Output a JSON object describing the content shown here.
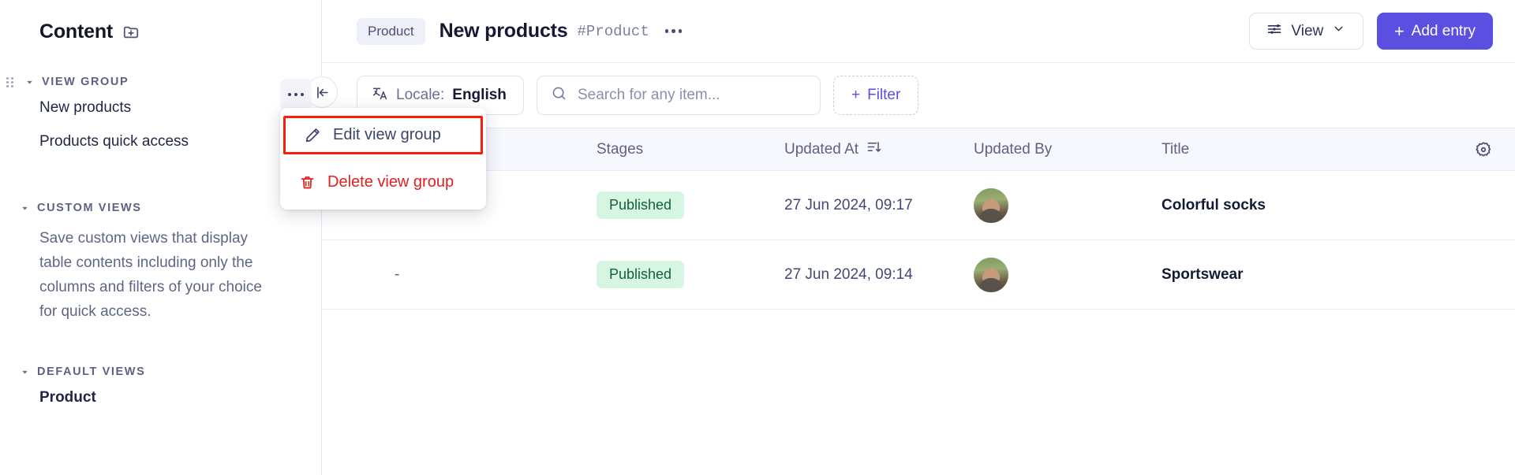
{
  "sidebar": {
    "title": "Content",
    "add_icon": "add-folder-icon",
    "sections": [
      {
        "label": "VIEW GROUP",
        "items": [
          {
            "label": "New products"
          },
          {
            "label": "Products quick access"
          }
        ]
      },
      {
        "label": "CUSTOM VIEWS",
        "description": "Save custom views that display table contents including only the columns and filters of your choice for quick access.",
        "items": []
      },
      {
        "label": "DEFAULT VIEWS",
        "items": [
          {
            "label": "Product"
          }
        ]
      }
    ],
    "more_button_icon": "ellipsis-icon"
  },
  "header": {
    "breadcrumb_chip": "Product",
    "page_title": "New products",
    "page_tag": "#Product",
    "more_icon": "ellipsis-icon",
    "view_button": {
      "label": "View",
      "icon": "sliders-icon",
      "chevron": "chevron-down-icon"
    },
    "add_button": {
      "label": "Add entry",
      "plus": "+"
    },
    "accent_color": "#5a4fe0"
  },
  "toolbar": {
    "collapse_icon": "collapse-left-icon",
    "locale": {
      "icon": "translate-icon",
      "label": "Locale:",
      "value": "English"
    },
    "search": {
      "placeholder": "Search for any item...",
      "value": "",
      "icon": "search-icon"
    },
    "filter": {
      "label": "Filter",
      "plus": "+"
    }
  },
  "table": {
    "columns": [
      "",
      "",
      "Stages",
      "Updated At",
      "Updated By",
      "Title"
    ],
    "sort_column": "Updated At",
    "sort_icon": "sort-descending-icon",
    "settings_icon": "gear-icon",
    "rows": [
      {
        "dash": "-",
        "stage": "Published",
        "updated_at": "27 Jun 2024, 09:17",
        "updated_by": "avatar",
        "title": "Colorful socks"
      },
      {
        "dash": "-",
        "stage": "Published",
        "updated_at": "27 Jun 2024, 09:14",
        "updated_by": "avatar",
        "title": "Sportswear"
      }
    ],
    "badge_bg": "#d6f5e3",
    "badge_fg": "#15603a"
  },
  "context_menu": {
    "items": [
      {
        "label": "Edit view group",
        "icon": "pencil-icon",
        "highlighted": true
      },
      {
        "label": "Delete view group",
        "icon": "trash-icon",
        "danger": true
      }
    ],
    "highlight_color": "#f81f0a"
  }
}
